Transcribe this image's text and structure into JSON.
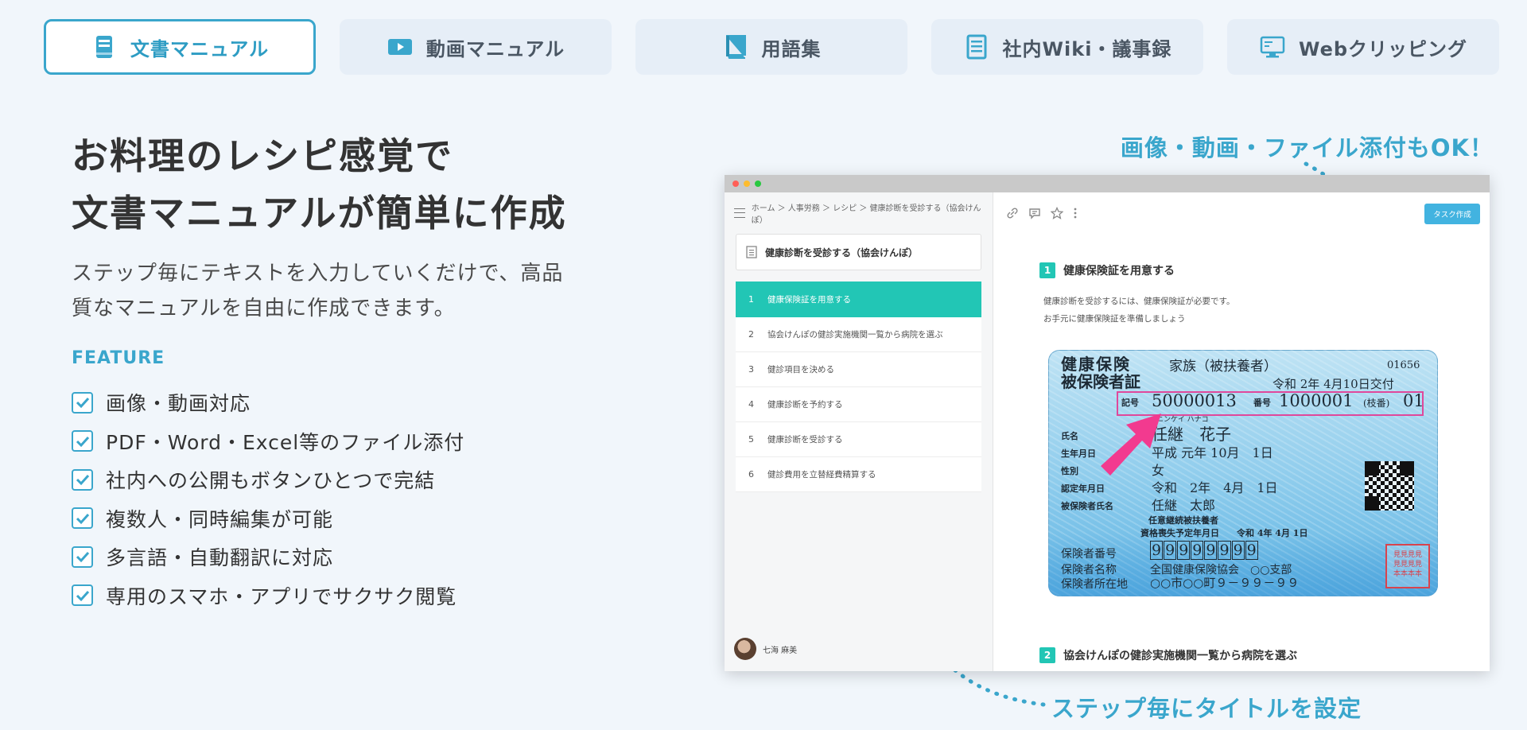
{
  "tabs": [
    {
      "label": "文書マニュアル",
      "icon": "book-icon",
      "active": true
    },
    {
      "label": "動画マニュアル",
      "icon": "video-play-icon",
      "active": false
    },
    {
      "label": "用語集",
      "icon": "glossary-book-icon",
      "active": false
    },
    {
      "label": "社内Wiki・議事録",
      "icon": "notepad-icon",
      "active": false
    },
    {
      "label": "Webクリッピング",
      "icon": "monitor-icon",
      "active": false
    }
  ],
  "hero": {
    "headline_line1": "お料理のレシピ感覚で",
    "headline_line2": "文書マニュアルが簡単に作成",
    "desc_line1": "ステップ毎にテキストを入力していくだけで、高品",
    "desc_line2": "質なマニュアルを自由に作成できます。"
  },
  "feature": {
    "label": "FEATURE",
    "items": [
      "画像・動画対応",
      "PDF・Word・Excel等のファイル添付",
      "社内への公開もボタンひとつで完結",
      "複数人・同時編集が可能",
      "多言語・自動翻訳に対応",
      "専用のスマホ・アプリでサクサク閲覧"
    ]
  },
  "callouts": {
    "top": "画像・動画・ファイル添付もOK！",
    "bottom": "ステップ毎にタイトルを設定"
  },
  "app": {
    "breadcrumb": "ホーム ＞ 人事労務 ＞ レシピ ＞ 健康診断を受診する（協会けんぽ）",
    "doc_title": "健康診断を受診する（協会けんぽ）",
    "task_button": "タスク作成",
    "steps": [
      {
        "num": "1",
        "label": "健康保険証を用意する"
      },
      {
        "num": "2",
        "label": "協会けんぽの健診実施機関一覧から病院を選ぶ"
      },
      {
        "num": "3",
        "label": "健診項目を決める"
      },
      {
        "num": "4",
        "label": "健康診断を予約する"
      },
      {
        "num": "5",
        "label": "健康診断を受診する"
      },
      {
        "num": "6",
        "label": "健診費用を立替経費精算する"
      }
    ],
    "user_name": "七海 麻美",
    "section1": {
      "num": "1",
      "title": "健康保険証を用意する",
      "text1": "健康診断を受診するには、健康保険証が必要です。",
      "text2": "お手元に健康保険証を準備しましょう"
    },
    "section2": {
      "num": "2",
      "title": "協会けんぽの健診実施機関一覧から病院を選ぶ"
    }
  },
  "card": {
    "title1": "健康保険",
    "title2": "被保険者証",
    "family": "家族（被扶養者）",
    "code": "01656",
    "issue": "令和 2年 4月10日交付",
    "kigo_label": "記号",
    "kigo": "50000013",
    "bango_label": "番号",
    "bango": "1000001",
    "edaban_label": "(枝番)",
    "edaban": "01",
    "furigana": "ニンケイ ハナコ",
    "name_label": "氏名",
    "name": "任継　花子",
    "birth_label": "生年月日",
    "birth": "平成 元年 10月　1日",
    "sex_label": "性別",
    "sex": "女",
    "cert_label": "認定年月日",
    "cert": "令和　2年　4月　1日",
    "insured_label": "被保険者氏名",
    "insured": "任継　太郎",
    "note1": "任意継続被扶養者",
    "note2": "資格喪失予定年月日　　令和 4年 4月 1日",
    "insurer_no_label": "保険者番号",
    "insurer_no_digits": [
      "9",
      "9",
      "9",
      "9",
      "9",
      "9",
      "9",
      "9"
    ],
    "insurer_name_label": "保険者名称",
    "insurer_name": "全国健康保険協会　○○支部",
    "insurer_addr_label": "保険者所在地",
    "insurer_addr": "○○市○○町９－９９－９９",
    "seal_text": "見見見見\n見見見見\n本本本本"
  }
}
